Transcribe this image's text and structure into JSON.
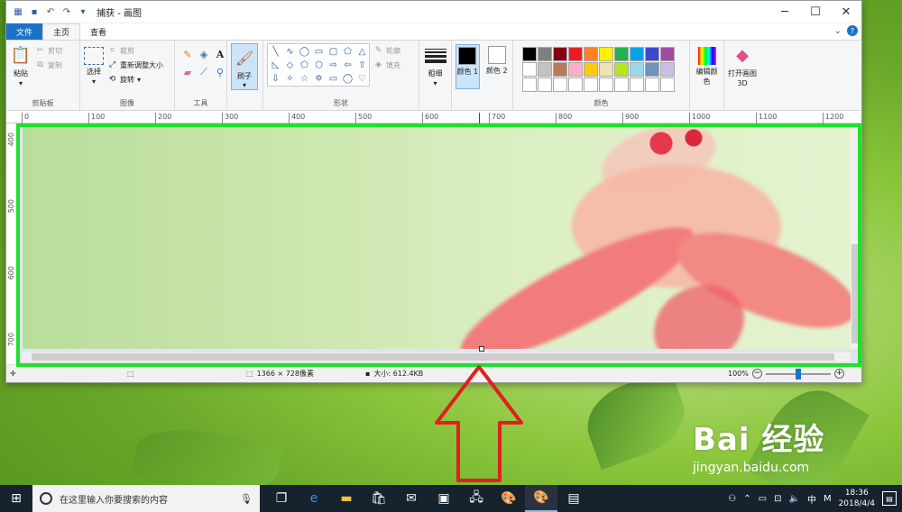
{
  "window": {
    "title": "捕获 - 画图",
    "minimize": "─",
    "maximize": "☐",
    "close": "✕"
  },
  "quick_access": {
    "app_icon": "paint-app-icon",
    "save_icon": "save-icon",
    "undo_icon": "undo-icon",
    "redo_icon": "redo-icon",
    "customize": "▾"
  },
  "tabs": {
    "file": "文件",
    "home": "主页",
    "view": "查看",
    "collapse": "⌄",
    "help": "?"
  },
  "ribbon": {
    "clipboard": {
      "group_label": "剪贴板",
      "paste": "粘贴",
      "paste_arrow": "▾",
      "cut": "剪切",
      "copy": "复制"
    },
    "image": {
      "group_label": "图像",
      "select": "选择",
      "select_arrow": "▾",
      "crop": "裁剪",
      "resize": "重新调整大小",
      "rotate": "旋转",
      "rotate_arrow": "▾"
    },
    "tools": {
      "group_label": "工具"
    },
    "brushes": {
      "label": "刷子",
      "arrow": "▾"
    },
    "shapes": {
      "group_label": "形状",
      "outline": "轮廓",
      "fill": "填充"
    },
    "size": {
      "label": "粗细",
      "arrow": "▾"
    },
    "colors": {
      "group_label": "颜色",
      "color1": "颜色 1",
      "color2": "颜色 2",
      "color1_value": "#000000",
      "color2_value": "#ffffff",
      "edit": "编辑颜色",
      "palette_row1": [
        "#000000",
        "#7f7f7f",
        "#880015",
        "#ed1c24",
        "#ff7f27",
        "#fff200",
        "#22b14c",
        "#00a2e8",
        "#3f48cc",
        "#a349a4"
      ],
      "palette_row2": [
        "#ffffff",
        "#c3c3c3",
        "#b97a57",
        "#ffaec9",
        "#ffc90e",
        "#efe4b0",
        "#b5e61d",
        "#99d9ea",
        "#7092be",
        "#c8bfe7"
      ],
      "palette_row3": [
        "#ffffff",
        "#ffffff",
        "#ffffff",
        "#ffffff",
        "#ffffff",
        "#ffffff",
        "#ffffff",
        "#ffffff",
        "#ffffff",
        "#ffffff"
      ]
    },
    "paint3d": {
      "label": "打开画图 3D"
    }
  },
  "rulers": {
    "horizontal": [
      "0",
      "100",
      "200",
      "300",
      "400",
      "500",
      "600",
      "700",
      "800",
      "900",
      "1000",
      "1100",
      "1200"
    ],
    "vertical": [
      "400",
      "500",
      "600",
      "700"
    ]
  },
  "status": {
    "dimensions": "1366 × 728像素",
    "size": "大小: 612.4KB",
    "zoom": "100%",
    "zoom_out": "−",
    "zoom_in": "+",
    "zoom_level": 0.5
  },
  "annotation": {
    "highlight_color": "#1fe02c",
    "arrow_color": "#e02020"
  },
  "watermark": {
    "logo": "Bai 经验",
    "url": "jingyan.baidu.com"
  },
  "taskbar": {
    "search_placeholder": "在这里输入你要搜索的内容",
    "time": "18:36",
    "date": "2018/4/4",
    "ime": "中",
    "ime_mode": "M"
  }
}
